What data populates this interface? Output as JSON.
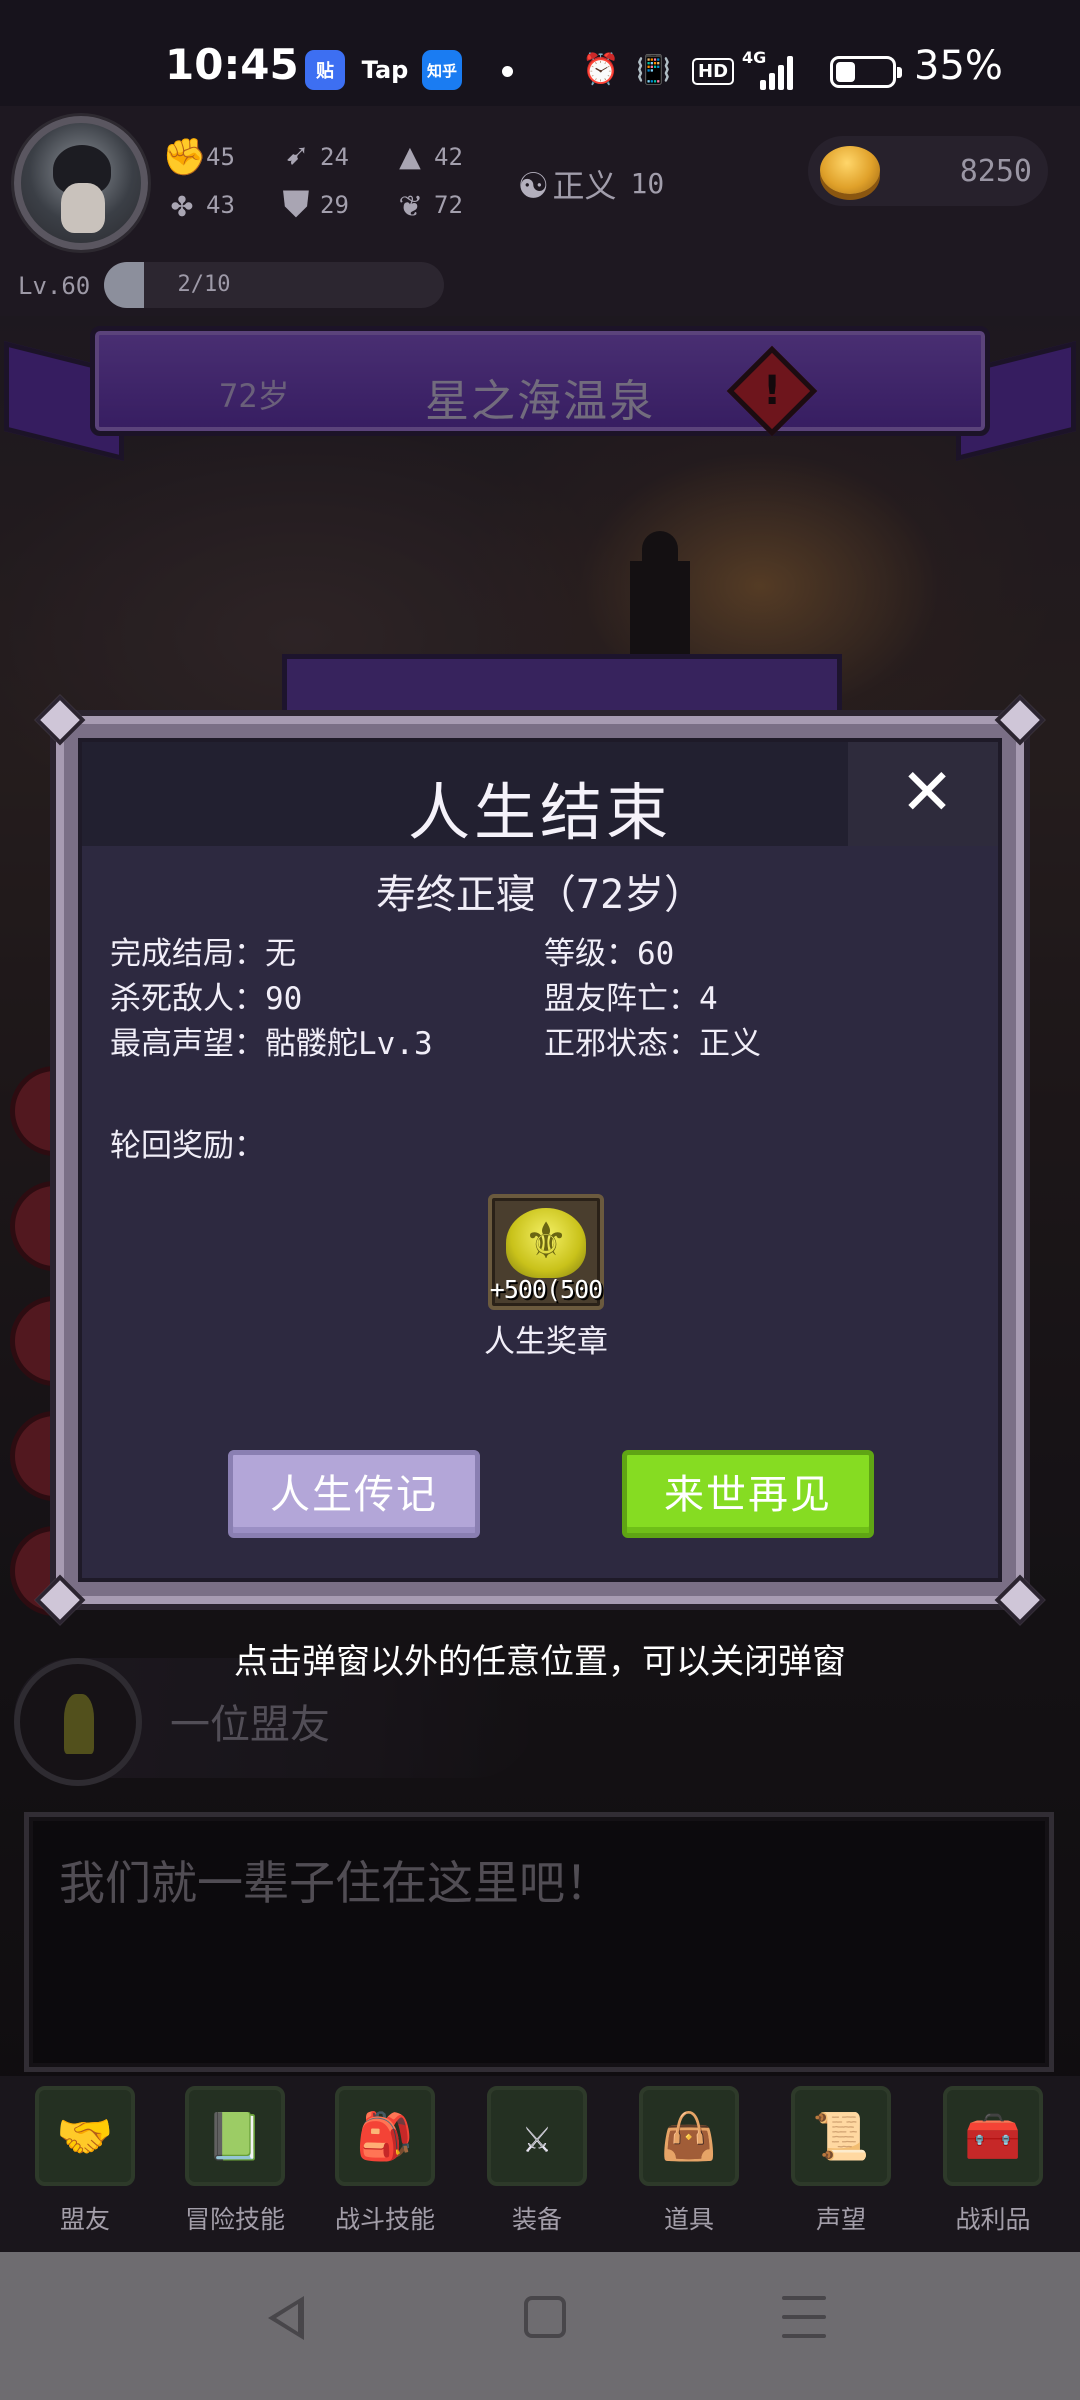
{
  "status_bar": {
    "time": "10:45",
    "apps": [
      "贴",
      "Tap",
      "知乎"
    ],
    "network": "4G",
    "hd": "HD",
    "battery_percent": "35%",
    "battery_level": 0.35
  },
  "header": {
    "stats": [
      {
        "icon": "fist-icon",
        "glyph": "✊",
        "value": "45"
      },
      {
        "icon": "boot-icon",
        "glyph": "➹",
        "value": "24"
      },
      {
        "icon": "wizard-hat-icon",
        "glyph": "▲",
        "value": "42"
      },
      {
        "icon": "clover-icon",
        "glyph": "✤",
        "value": "43"
      },
      {
        "icon": "armor-icon",
        "glyph": "⛊",
        "value": "29"
      },
      {
        "icon": "lotus-icon",
        "glyph": "❦",
        "value": "72"
      }
    ],
    "alignment_label": "正义",
    "alignment_value": "10",
    "gold": "8250",
    "level": "Lv.60",
    "level_progress": "2/10",
    "level_fraction": 0.2
  },
  "scene": {
    "age": "72岁",
    "location": "星之海温泉",
    "ally_name": "一位盟友",
    "dialog": "我们就一辈子住在这里吧！"
  },
  "modal": {
    "title": "人生结束",
    "death_cause": "寿终正寝（72岁）",
    "info_left": [
      "完成结局：无",
      "杀死敌人：90",
      "最高声望：骷髅舵Lv.3"
    ],
    "info_right": [
      "等级：60",
      "盟友阵亡：4",
      "正邪状态：正义"
    ],
    "reward_title": "轮回奖励：",
    "reward_amount": "+500(500",
    "reward_name": "人生奖章",
    "biography_button": "人生传记",
    "next_life_button": "来世再见",
    "close_hint": "点击弹窗以外的任意位置，可以关闭弹窗"
  },
  "tabs": [
    {
      "label": "盟友",
      "icon": "allies-icon",
      "glyph": "🤝"
    },
    {
      "label": "冒险技能",
      "icon": "book-icon",
      "glyph": "📗"
    },
    {
      "label": "战斗技能",
      "icon": "backpack-icon",
      "glyph": "🎒"
    },
    {
      "label": "装备",
      "icon": "swords-icon",
      "glyph": "⚔"
    },
    {
      "label": "道具",
      "icon": "pouch-icon",
      "glyph": "👜"
    },
    {
      "label": "声望",
      "icon": "scroll-icon",
      "glyph": "📜"
    },
    {
      "label": "战利品",
      "icon": "chest-icon",
      "glyph": "🧰"
    }
  ]
}
